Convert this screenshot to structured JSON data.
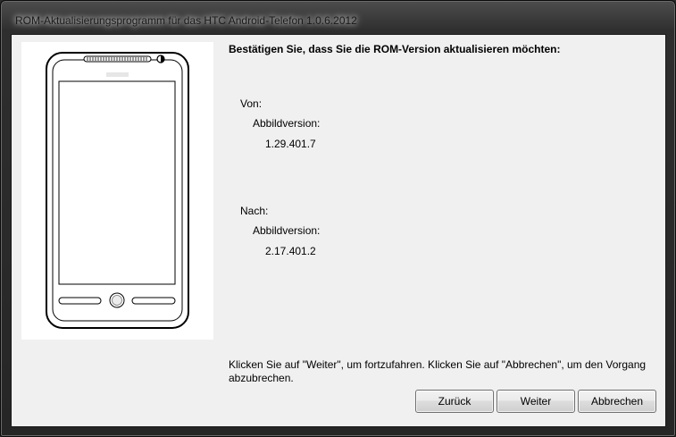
{
  "window": {
    "title": "ROM-Aktualisierungsprogramm für das HTC Android-Telefon 1.0.6.2012"
  },
  "main": {
    "heading": "Bestätigen Sie, dass Sie die ROM-Version aktualisieren möchten:",
    "from": {
      "label": "Von:",
      "image_label": "Abbildversion:",
      "version": "1.29.401.7"
    },
    "to": {
      "label": "Nach:",
      "image_label": "Abbildversion:",
      "version": "2.17.401.2"
    },
    "instructions": "Klicken Sie auf \"Weiter\", um fortzufahren. Klicken Sie auf \"Abbrechen\", um den Vorgang abzubrechen."
  },
  "buttons": {
    "back": "Zurück",
    "next": "Weiter",
    "cancel": "Abbrechen"
  },
  "colors": {
    "dialog_background": "#f0f0f0",
    "titlebar": "#2e2e2e"
  },
  "icons": {
    "phone_illustration": "phone-illustration-icon"
  }
}
